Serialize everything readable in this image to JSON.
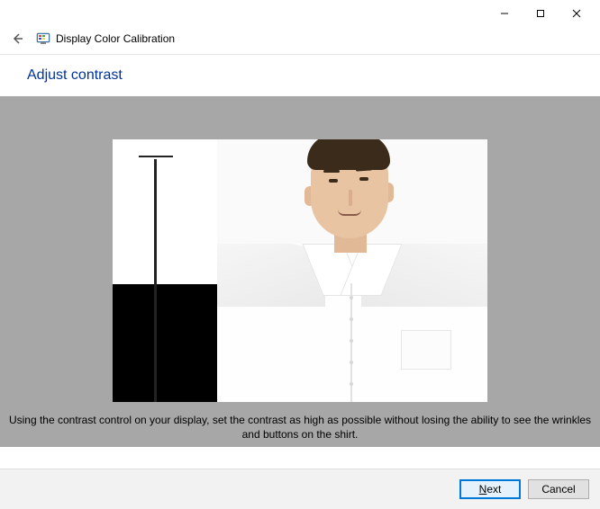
{
  "window": {
    "title": "Display Color Calibration"
  },
  "page": {
    "heading": "Adjust contrast",
    "instruction": "Using the contrast control on your display, set the contrast as high as possible without losing the ability to see the wrinkles and buttons on the shirt."
  },
  "buttons": {
    "next_prefix": "N",
    "next_suffix": "ext",
    "cancel": "Cancel"
  }
}
